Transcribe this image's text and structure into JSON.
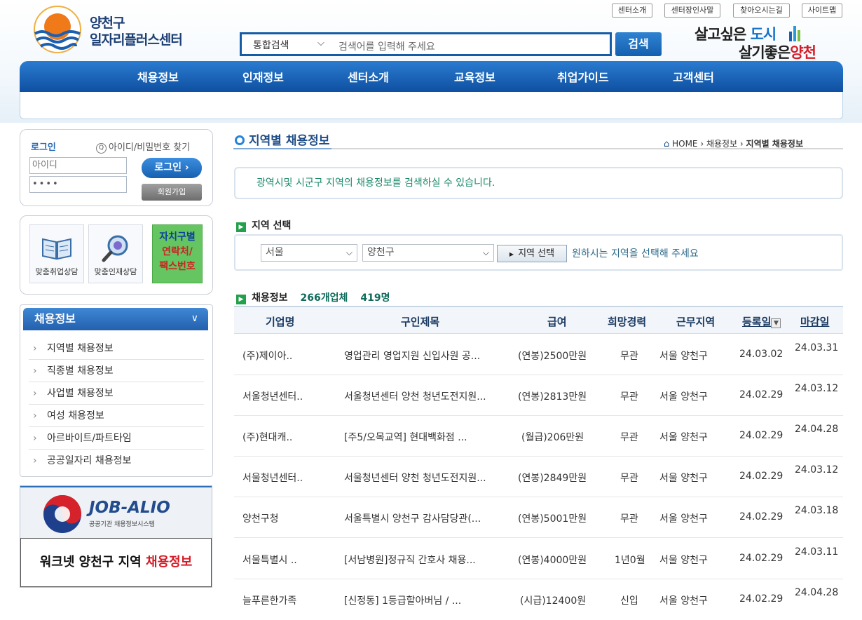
{
  "header": {
    "logo_line1": "양천구",
    "logo_line2": "일자리플러스센터",
    "util_links": [
      "센터소개",
      "센터장인사말",
      "찾아오시는길",
      "사이트맵"
    ],
    "search": {
      "scope": "통합검색",
      "placeholder": "검색어를 입력해 주세요",
      "button": "검색"
    },
    "slogan": {
      "line1_a": "살고싶은 ",
      "line1_b": "도시",
      "line2_a": "살기좋은",
      "line2_b": "양천"
    }
  },
  "gnb": [
    "채용정보",
    "인재정보",
    "센터소개",
    "교육정보",
    "취업가이드",
    "고객센터"
  ],
  "login": {
    "label": "로그인",
    "find": "아이디/비밀번호 찾기",
    "id_placeholder": "아이디",
    "pw_value": "••••",
    "login_button": "로그인",
    "join_button": "회원가입"
  },
  "quick": {
    "tile1": "맞춤취업상담",
    "tile2": "맞춤인재상담",
    "tile3_a": "자치구별",
    "tile3_b": "연락처/",
    "tile3_c": "팩스번호"
  },
  "side_menu": {
    "title": "채용정보",
    "items": [
      "지역별 채용정보",
      "직종별 채용정보",
      "사업별 채용정보",
      "여성 채용정보",
      "아르바이트/파트타임",
      "공공일자리 채용정보"
    ]
  },
  "banners": {
    "job_alio_title": "JOB-ALIO",
    "job_alio_sub": "공공기관 채용정보시스템",
    "worknet_a": "워크넷 양천구 지역 ",
    "worknet_b": "채용정보"
  },
  "main": {
    "title": "지역별 채용정보",
    "breadcrumb": {
      "home": "HOME",
      "level1": "채용정보",
      "level2": "지역별 채용정보"
    },
    "notice": "광역시및 시군구 지역의 채용정보를 검색하실 수 있습니다.",
    "region_heading": "지역 선택",
    "region_city": "서울",
    "region_district": "양천구",
    "region_button": "지역 선택",
    "region_hint": "원하시는 지역을 선택해 주세요",
    "list_heading": "채용정보",
    "company_count": "266개업체",
    "job_count": "419명"
  },
  "table": {
    "columns": [
      "기업명",
      "구인제목",
      "급여",
      "희망경력",
      "근무지역",
      "등록일",
      "마감일"
    ],
    "rows": [
      {
        "company": "(주)제이아..",
        "title": "영업관리 영업지원 신입사원 공...",
        "pay": "(연봉)2500만원",
        "career": "무관",
        "area": "서울 양천구",
        "reg": "24.03.02",
        "close": "24.03.31"
      },
      {
        "company": "서울청년센터..",
        "title": "서울청년센터 양천 청년도전지원...",
        "pay": "(연봉)2813만원",
        "career": "무관",
        "area": "서울 양천구",
        "reg": "24.02.29",
        "close": "24.03.12"
      },
      {
        "company": "(주)현대캐..",
        "title": "[주5/오목교역] 현대백화점 ...",
        "pay": "(월급)206만원",
        "career": "무관",
        "area": "서울 양천구",
        "reg": "24.02.29",
        "close": "24.04.28"
      },
      {
        "company": "서울청년센터..",
        "title": "서울청년센터 양천 청년도전지원...",
        "pay": "(연봉)2849만원",
        "career": "무관",
        "area": "서울 양천구",
        "reg": "24.02.29",
        "close": "24.03.12"
      },
      {
        "company": "양천구청",
        "title": "서울특별시 양천구 감사담당관(...",
        "pay": "(연봉)5001만원",
        "career": "무관",
        "area": "서울 양천구",
        "reg": "24.02.29",
        "close": "24.03.18"
      },
      {
        "company": "서울특별시 ..",
        "title": "[서남병원]정규직 간호사 채용...",
        "pay": "(연봉)4000만원",
        "career": "1년0월",
        "area": "서울 양천구",
        "reg": "24.02.29",
        "close": "24.03.11"
      },
      {
        "company": "늘푸른한가족",
        "title": "[신정동] 1등급할아버님 / ...",
        "pay": "(시급)12400원",
        "career": "신입",
        "area": "서울 양천구",
        "reg": "24.02.29",
        "close": "24.04.28"
      }
    ]
  }
}
